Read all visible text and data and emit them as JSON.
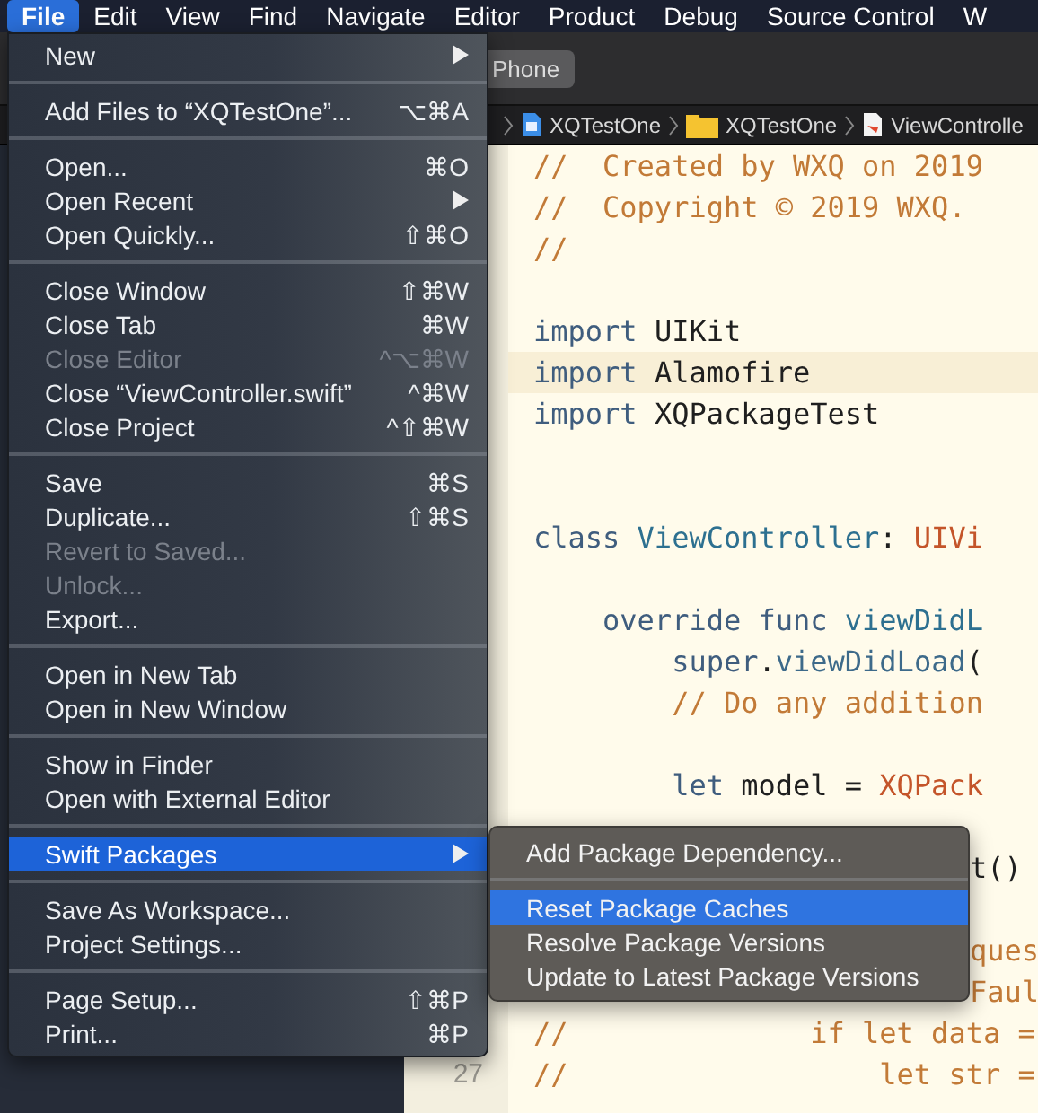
{
  "menu_bar": {
    "items": [
      {
        "label": "File",
        "selected": true
      },
      {
        "label": "Edit",
        "selected": false
      },
      {
        "label": "View",
        "selected": false
      },
      {
        "label": "Find",
        "selected": false
      },
      {
        "label": "Navigate",
        "selected": false
      },
      {
        "label": "Editor",
        "selected": false
      },
      {
        "label": "Product",
        "selected": false
      },
      {
        "label": "Debug",
        "selected": false
      },
      {
        "label": "Source Control",
        "selected": false
      },
      {
        "label": "W",
        "selected": false
      }
    ]
  },
  "toolbar": {
    "device_button": "Phone"
  },
  "breadcrumb": [
    {
      "label": "XQTestOne",
      "kind": "project"
    },
    {
      "label": "XQTestOne",
      "kind": "folder"
    },
    {
      "label": "ViewControlle",
      "kind": "swift"
    }
  ],
  "editor": {
    "lines": [
      {
        "kind": "code",
        "current": false,
        "segments": [
          {
            "t": "//  Created by WXQ on 2019",
            "kind": "comment"
          }
        ]
      },
      {
        "kind": "code",
        "current": false,
        "segments": [
          {
            "t": "//  Copyright © 2019 WXQ.",
            "kind": "comment"
          }
        ]
      },
      {
        "kind": "code",
        "current": false,
        "segments": [
          {
            "t": "//",
            "kind": "comment"
          }
        ]
      },
      {
        "kind": "blank"
      },
      {
        "kind": "code",
        "current": false,
        "segments": [
          {
            "t": "import ",
            "kind": "keyword"
          },
          {
            "t": "UIKit",
            "kind": "plain"
          }
        ]
      },
      {
        "kind": "code",
        "current": true,
        "segments": [
          {
            "t": "import ",
            "kind": "keyword"
          },
          {
            "t": "Alamofire",
            "kind": "plain"
          }
        ]
      },
      {
        "kind": "code",
        "current": false,
        "segments": [
          {
            "t": "import ",
            "kind": "keyword"
          },
          {
            "t": "XQPackageTest",
            "kind": "plain"
          }
        ]
      },
      {
        "kind": "blank"
      },
      {
        "kind": "blank"
      },
      {
        "kind": "code",
        "current": false,
        "segments": [
          {
            "t": "class ",
            "kind": "keyword"
          },
          {
            "t": "ViewController",
            "kind": "decl"
          },
          {
            "t": ": ",
            "kind": "plain"
          },
          {
            "t": "UIVi",
            "kind": "typeref"
          }
        ]
      },
      {
        "kind": "blank"
      },
      {
        "kind": "code",
        "current": false,
        "segments": [
          {
            "t": "    override func ",
            "kind": "keyword"
          },
          {
            "t": "viewDidL",
            "kind": "decl"
          }
        ]
      },
      {
        "kind": "code",
        "current": false,
        "segments": [
          {
            "t": "        super",
            "kind": "keyword"
          },
          {
            "t": ".",
            "kind": "plain"
          },
          {
            "t": "viewDidLoad",
            "kind": "call"
          },
          {
            "t": "(",
            "kind": "plain"
          }
        ]
      },
      {
        "kind": "code",
        "current": false,
        "segments": [
          {
            "t": "        // Do any addition",
            "kind": "comment"
          }
        ]
      },
      {
        "kind": "blank"
      },
      {
        "kind": "code",
        "current": false,
        "segments": [
          {
            "t": "        let ",
            "kind": "keyword"
          },
          {
            "t": "model = ",
            "kind": "plain"
          },
          {
            "t": "XQPack",
            "kind": "typeref"
          }
        ]
      },
      {
        "kind": "blank"
      },
      {
        "kind": "tail",
        "segments": [
          {
            "t": "t()",
            "kind": "plain"
          }
        ]
      },
      {
        "kind": "blank"
      },
      {
        "kind": "tail",
        "segments": [
          {
            "t": "ques",
            "kind": "comment"
          }
        ]
      },
      {
        "kind": "tail",
        "segments": [
          {
            "t": "Faul",
            "kind": "comment"
          }
        ]
      },
      {
        "kind": "code",
        "current": false,
        "segments": [
          {
            "t": "//              if let data =",
            "kind": "comment"
          }
        ]
      },
      {
        "kind": "code",
        "current": false,
        "number": "27",
        "segments": [
          {
            "t": "//                  let str =",
            "kind": "comment"
          }
        ]
      }
    ]
  },
  "file_menu": {
    "sections": [
      [
        {
          "label": "New",
          "submenu": true,
          "disabled": false,
          "selected": false
        }
      ],
      [
        {
          "label": "Add Files to “XQTestOne”...",
          "shortcut": "⌥⌘A",
          "submenu": false,
          "disabled": false,
          "selected": false
        }
      ],
      [
        {
          "label": "Open...",
          "shortcut": "⌘O",
          "submenu": false,
          "disabled": false,
          "selected": false
        },
        {
          "label": "Open Recent",
          "submenu": true,
          "disabled": false,
          "selected": false
        },
        {
          "label": "Open Quickly...",
          "shortcut": "⇧⌘O",
          "submenu": false,
          "disabled": false,
          "selected": false
        }
      ],
      [
        {
          "label": "Close Window",
          "shortcut": "⇧⌘W",
          "submenu": false,
          "disabled": false,
          "selected": false
        },
        {
          "label": "Close Tab",
          "shortcut": "⌘W",
          "submenu": false,
          "disabled": false,
          "selected": false
        },
        {
          "label": "Close Editor",
          "shortcut": "^⌥⌘W",
          "submenu": false,
          "disabled": true,
          "selected": false
        },
        {
          "label": "Close “ViewController.swift”",
          "shortcut": "^⌘W",
          "submenu": false,
          "disabled": false,
          "selected": false
        },
        {
          "label": "Close Project",
          "shortcut": "^⇧⌘W",
          "submenu": false,
          "disabled": false,
          "selected": false
        }
      ],
      [
        {
          "label": "Save",
          "shortcut": "⌘S",
          "submenu": false,
          "disabled": false,
          "selected": false
        },
        {
          "label": "Duplicate...",
          "shortcut": "⇧⌘S",
          "submenu": false,
          "disabled": false,
          "selected": false
        },
        {
          "label": "Revert to Saved...",
          "submenu": false,
          "disabled": true,
          "selected": false
        },
        {
          "label": "Unlock...",
          "submenu": false,
          "disabled": true,
          "selected": false
        },
        {
          "label": "Export...",
          "submenu": false,
          "disabled": false,
          "selected": false
        }
      ],
      [
        {
          "label": "Open in New Tab",
          "submenu": false,
          "disabled": false,
          "selected": false
        },
        {
          "label": "Open in New Window",
          "submenu": false,
          "disabled": false,
          "selected": false
        }
      ],
      [
        {
          "label": "Show in Finder",
          "submenu": false,
          "disabled": false,
          "selected": false
        },
        {
          "label": "Open with External Editor",
          "submenu": false,
          "disabled": false,
          "selected": false
        }
      ],
      [
        {
          "label": "Swift Packages",
          "submenu": true,
          "disabled": false,
          "selected": true
        }
      ],
      [
        {
          "label": "Save As Workspace...",
          "submenu": false,
          "disabled": false,
          "selected": false
        },
        {
          "label": "Project Settings...",
          "submenu": false,
          "disabled": false,
          "selected": false
        }
      ],
      [
        {
          "label": "Page Setup...",
          "shortcut": "⇧⌘P",
          "submenu": false,
          "disabled": false,
          "selected": false
        },
        {
          "label": "Print...",
          "shortcut": "⌘P",
          "submenu": false,
          "disabled": false,
          "selected": false
        }
      ]
    ]
  },
  "swift_packages_menu": {
    "sections": [
      [
        {
          "label": "Add Package Dependency...",
          "selected": false
        }
      ],
      [
        {
          "label": "Reset Package Caches",
          "selected": true
        },
        {
          "label": "Resolve Package Versions",
          "selected": false
        },
        {
          "label": "Update to Latest Package Versions",
          "selected": false
        }
      ]
    ]
  }
}
